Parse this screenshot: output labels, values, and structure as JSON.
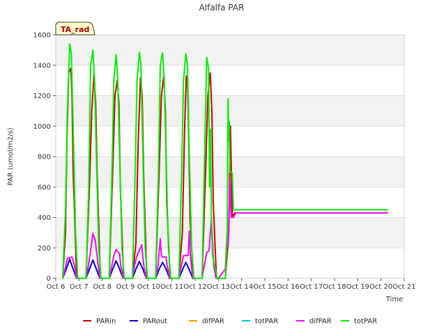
{
  "chart_data": {
    "type": "line",
    "title": "Alfalfa PAR",
    "xlabel": "Time",
    "ylabel": "PAR (umol/m2/s)",
    "badge": "TA_rad",
    "x_ticks": [
      "Oct 6",
      "Oct 7",
      "Oct 8",
      "Oct 9",
      "Oct 10",
      "Oct 11",
      "Oct 12",
      "Oct 13",
      "Oct 14",
      "Oct 15",
      "Oct 16",
      "Oct 17",
      "Oct 18",
      "Oct 19",
      "Oct 20",
      "Oct 21"
    ],
    "xlim": [
      6,
      21
    ],
    "ylim": [
      0,
      1600
    ],
    "y_ticks": [
      0,
      200,
      400,
      600,
      800,
      1000,
      1200,
      1400,
      1600
    ],
    "grid": true,
    "legend_placement": "bottom",
    "series": [
      {
        "name": "PARin",
        "color": "#cc0000",
        "x": [
          6.3,
          6.42,
          6.48,
          6.56,
          6.65,
          6.7,
          6.75,
          6.9,
          7.0,
          7.3,
          7.45,
          7.55,
          7.65,
          7.72,
          7.78,
          7.92,
          8.0,
          8.3,
          8.45,
          8.55,
          8.65,
          8.72,
          8.78,
          8.92,
          9.0,
          9.3,
          9.45,
          9.55,
          9.65,
          9.72,
          9.78,
          9.92,
          10.0,
          10.3,
          10.45,
          10.55,
          10.65,
          10.72,
          10.78,
          10.92,
          11.0,
          11.3,
          11.45,
          11.55,
          11.62,
          11.67,
          11.72,
          11.78,
          11.92,
          12.0,
          12.3,
          12.45,
          12.55,
          12.65,
          12.72,
          12.78,
          12.92,
          13.0,
          13.3,
          13.45,
          13.52,
          13.56,
          13.6,
          13.7,
          14.0,
          20.3
        ],
        "y": [
          0,
          300,
          900,
          1350,
          1380,
          1200,
          700,
          0,
          0,
          0,
          600,
          1100,
          1350,
          1150,
          700,
          0,
          0,
          0,
          700,
          1200,
          1300,
          1150,
          600,
          0,
          0,
          0,
          230,
          900,
          1320,
          1200,
          700,
          0,
          0,
          0,
          700,
          1200,
          1330,
          1100,
          500,
          0,
          0,
          0,
          300,
          1000,
          1330,
          1300,
          950,
          400,
          0,
          0,
          0,
          700,
          1200,
          1350,
          1100,
          500,
          0,
          0,
          0,
          300,
          1000,
          700,
          400,
          430,
          430,
          430
        ]
      },
      {
        "name": "PARout",
        "color": "#0000cc",
        "x": [
          6.3,
          6.45,
          6.6,
          6.75,
          6.9,
          7.0,
          7.3,
          7.45,
          7.6,
          7.75,
          7.9,
          8.0,
          8.3,
          8.45,
          8.6,
          8.75,
          8.9,
          9.0,
          9.3,
          9.45,
          9.6,
          9.75,
          9.9,
          10.0,
          10.3,
          10.45,
          10.6,
          10.75,
          10.9,
          11.0,
          11.3,
          11.45,
          11.6,
          11.75,
          11.9,
          12.0
        ],
        "y": [
          0,
          60,
          125,
          60,
          0,
          0,
          0,
          60,
          120,
          60,
          0,
          0,
          0,
          60,
          115,
          60,
          0,
          0,
          0,
          60,
          110,
          60,
          0,
          0,
          0,
          60,
          105,
          60,
          0,
          0,
          0,
          55,
          105,
          55,
          0,
          0
        ]
      },
      {
        "name": "difPAR",
        "color": "#ff9900",
        "x": [],
        "y": []
      },
      {
        "name": "totPAR",
        "color": "#00cccc",
        "x": [],
        "y": []
      },
      {
        "name": "difPAR",
        "color": "#ff00ff",
        "x": [
          6.3,
          6.4,
          6.5,
          6.7,
          6.8,
          6.9,
          7.0,
          7.3,
          7.4,
          7.5,
          7.6,
          7.7,
          7.8,
          7.9,
          8.0,
          8.3,
          8.4,
          8.5,
          8.6,
          8.75,
          8.8,
          8.9,
          9.0,
          9.3,
          9.4,
          9.5,
          9.7,
          9.75,
          9.8,
          9.9,
          10.0,
          10.3,
          10.4,
          10.5,
          10.55,
          10.6,
          10.75,
          10.8,
          10.9,
          11.0,
          11.3,
          11.4,
          11.5,
          11.7,
          11.75,
          11.8,
          11.9,
          12.0,
          12.3,
          12.4,
          12.5,
          12.6,
          12.7,
          12.75,
          12.8,
          12.9,
          13.0,
          13.3,
          13.38,
          13.42,
          13.5,
          13.55,
          13.65,
          13.75,
          14.0,
          20.3
        ],
        "y": [
          0,
          60,
          130,
          140,
          90,
          0,
          0,
          0,
          80,
          180,
          295,
          250,
          120,
          0,
          0,
          0,
          70,
          150,
          190,
          160,
          80,
          0,
          0,
          0,
          90,
          150,
          220,
          140,
          70,
          0,
          0,
          0,
          80,
          260,
          150,
          140,
          140,
          80,
          0,
          0,
          0,
          80,
          150,
          150,
          310,
          140,
          0,
          0,
          0,
          90,
          170,
          180,
          390,
          250,
          80,
          0,
          0,
          60,
          310,
          210,
          650,
          400,
          400,
          430,
          430,
          430
        ]
      },
      {
        "name": "totPAR",
        "color": "#00ee00",
        "x": [
          6.3,
          6.42,
          6.5,
          6.6,
          6.67,
          6.75,
          6.85,
          6.95,
          7.0,
          7.3,
          7.42,
          7.5,
          7.6,
          7.67,
          7.75,
          7.85,
          7.95,
          8.0,
          8.3,
          8.42,
          8.5,
          8.6,
          8.67,
          8.75,
          8.85,
          8.95,
          9.0,
          9.3,
          9.42,
          9.5,
          9.6,
          9.67,
          9.75,
          9.85,
          9.95,
          10.0,
          10.3,
          10.42,
          10.5,
          10.6,
          10.67,
          10.75,
          10.85,
          10.95,
          11.0,
          11.3,
          11.42,
          11.5,
          11.6,
          11.67,
          11.75,
          11.85,
          11.95,
          12.0,
          12.3,
          12.42,
          12.5,
          12.58,
          12.62,
          12.66,
          12.7,
          12.75,
          12.95,
          13.0,
          13.3,
          13.38,
          13.42,
          13.45,
          13.47,
          13.5,
          13.55,
          13.6,
          13.65,
          13.7,
          13.75,
          14.0,
          20.3
        ],
        "y": [
          0,
          450,
          1100,
          1540,
          1480,
          1000,
          300,
          0,
          0,
          0,
          600,
          1400,
          1500,
          1300,
          800,
          200,
          0,
          0,
          0,
          700,
          1300,
          1470,
          1300,
          800,
          200,
          0,
          0,
          0,
          700,
          1300,
          1485,
          1400,
          800,
          200,
          0,
          0,
          0,
          700,
          1400,
          1480,
          1300,
          800,
          200,
          0,
          0,
          0,
          700,
          1300,
          1475,
          1400,
          800,
          200,
          0,
          0,
          0,
          900,
          1450,
          1380,
          600,
          980,
          400,
          150,
          0,
          0,
          0,
          300,
          1180,
          900,
          1030,
          700,
          700,
          690,
          450,
          450,
          450,
          450,
          450
        ]
      }
    ]
  }
}
